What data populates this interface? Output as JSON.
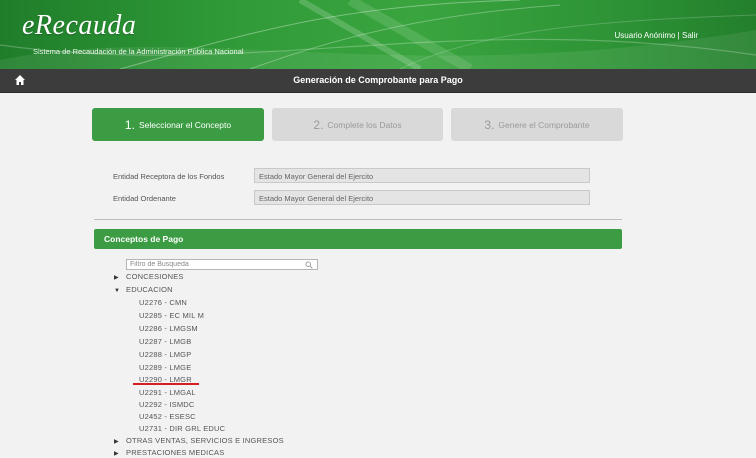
{
  "header": {
    "logo": "eRecauda",
    "subtitle": "Sistema de Recaudación de la Administración Pública Nacional",
    "user_label": "Usuario Anónimo",
    "separator": "|",
    "logout_label": "Salir"
  },
  "nav": {
    "home_icon": "home-icon",
    "title": "Generación de Comprobante para Pago"
  },
  "steps": [
    {
      "number": "1.",
      "label": "Seleccionar el Concepto",
      "state": "active"
    },
    {
      "number": "2.",
      "label": "Complete los Datos",
      "state": "inactive"
    },
    {
      "number": "3.",
      "label": "Genere el Comprobante",
      "state": "inactive"
    }
  ],
  "fields": [
    {
      "label": "Entidad Receptora de los Fondos",
      "value": "Estado Mayor General del Ejercito"
    },
    {
      "label": "Entidad Ordenante",
      "value": "Estado Mayor General del Ejercito"
    }
  ],
  "concepts": {
    "title": "Conceptos de Pago",
    "filter_placeholder": "Filtro de Busqueda",
    "tree": [
      {
        "label": "CONCESIONES",
        "expanded": false
      },
      {
        "label": "EDUCACION",
        "expanded": true
      },
      {
        "label": "OTRAS VENTAS, SERVICIOS E INGRESOS",
        "expanded": false
      },
      {
        "label": "PRESTACIONES MEDICAS",
        "expanded": false
      }
    ],
    "education_children": [
      "U2276 - CMN",
      "U2285 - EC MIL M",
      "U2286 - LMGSM",
      "U2287 - LMGB",
      "U2288 - LMGP",
      "U2289 - LMGE",
      "U2290 - LMGR",
      "U2291 - LMGAL",
      "U2292 - ISMDC",
      "U2452 - ESESC",
      "U2731 - DIR GRL EDUC"
    ],
    "highlighted_item": "U2290 - LMGR"
  },
  "colors": {
    "brand_green": "#3b9c43",
    "nav_dark": "#3c3c3c",
    "inactive_step": "#d9d9d9",
    "highlight_red": "#d42020"
  }
}
